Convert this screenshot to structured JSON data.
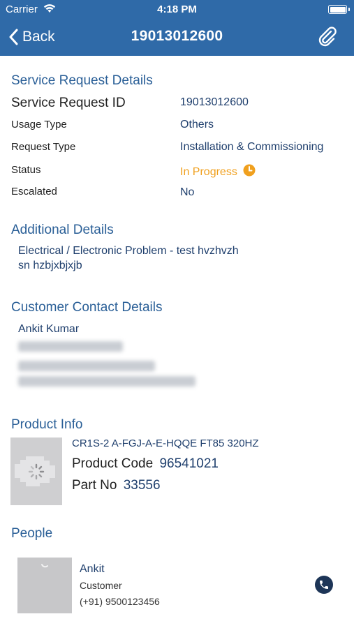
{
  "status_bar": {
    "carrier": "Carrier",
    "time": "4:18 PM"
  },
  "nav": {
    "back_label": "Back",
    "title": "19013012600"
  },
  "service_request": {
    "section_title": "Service Request Details",
    "id_label": "Service Request ID",
    "id_value": "19013012600",
    "usage_type_label": "Usage Type",
    "usage_type_value": "Others",
    "request_type_label": "Request Type",
    "request_type_value": "Installation & Commissioning",
    "status_label": "Status",
    "status_value": "In Progress",
    "escalated_label": "Escalated",
    "escalated_value": "No"
  },
  "additional_details": {
    "section_title": "Additional Details",
    "line1": "Electrical / Electronic Problem - test hvzhvzh",
    "line2": "sn hzbjxbjxjb"
  },
  "customer_contact": {
    "section_title": "Customer Contact Details",
    "name": "Ankit Kumar"
  },
  "product_info": {
    "section_title": "Product Info",
    "model": "CR1S-2 A-FGJ-A-E-HQQE FT85 320HZ",
    "product_code_label": "Product Code",
    "product_code_value": "96541021",
    "part_no_label": "Part No",
    "part_no_value": "33556"
  },
  "people": {
    "section_title": "People",
    "items": [
      {
        "name": "Ankit",
        "role": "Customer",
        "phone": "(+91) 9500123456"
      }
    ]
  },
  "colors": {
    "nav_bar": "#2f6aa8",
    "section_title": "#2a5f97",
    "status_in_progress": "#f0a01e",
    "value_text": "#1f3f6d"
  },
  "icons": [
    "wifi-icon",
    "battery-icon",
    "back-chevron-icon",
    "paperclip-icon",
    "clock-icon",
    "loading-spinner-icon",
    "phone-icon"
  ]
}
